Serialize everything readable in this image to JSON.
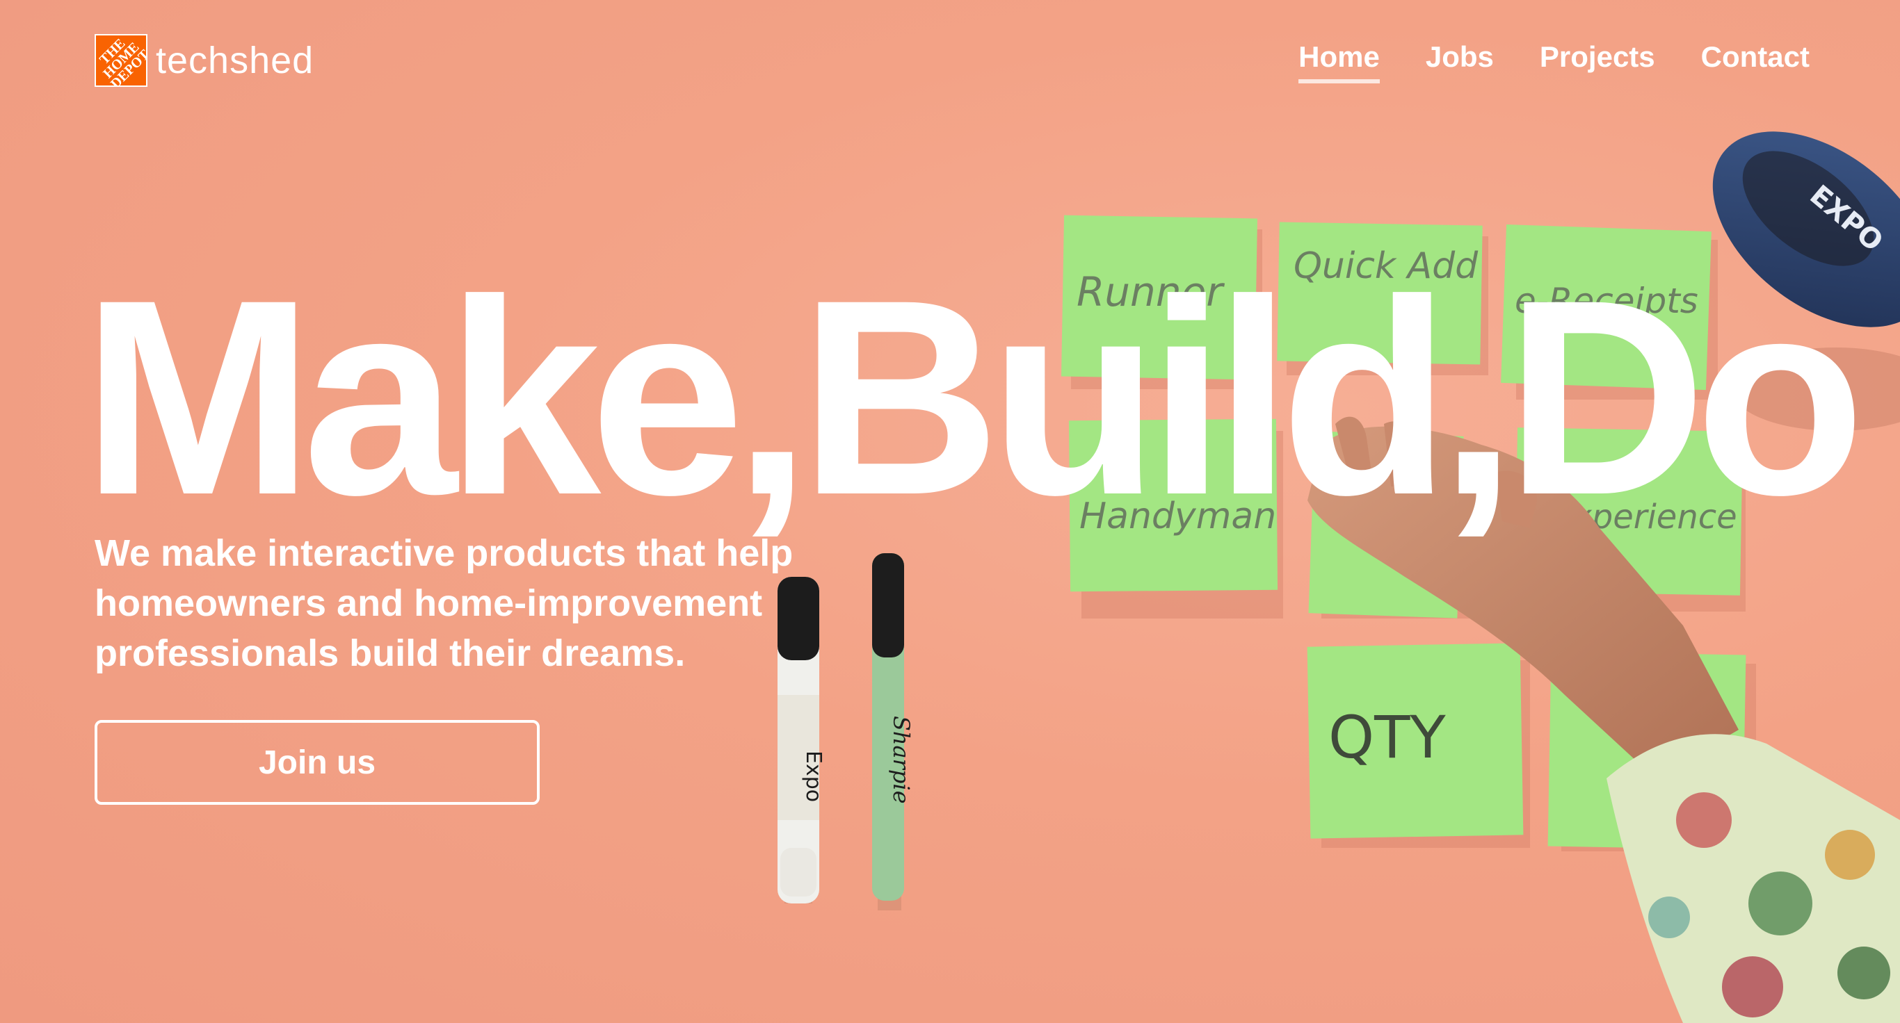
{
  "brand": {
    "name": "techshed",
    "logo_mark_text": "THE\nHOME\nDEPOT",
    "logo_color": "#f96302"
  },
  "nav": {
    "items": [
      {
        "label": "Home",
        "active": true
      },
      {
        "label": "Jobs",
        "active": false
      },
      {
        "label": "Projects",
        "active": false
      },
      {
        "label": "Contact",
        "active": false
      }
    ]
  },
  "hero": {
    "headline": "Make,Build,Do",
    "subhead": "We make interactive products that help homeowners and home-improvement professionals build their dreams.",
    "cta_label": "Join us",
    "background_color": "#f2a48a"
  },
  "photo": {
    "sticky_notes": [
      "Runner",
      "Quick Add",
      "e-Receipts",
      "Handyman",
      "Experience",
      "QTY"
    ],
    "marker_labels": [
      "Expo",
      "Sharpie"
    ],
    "eraser_label": "EXPO",
    "note_color": "#9ee37a"
  }
}
